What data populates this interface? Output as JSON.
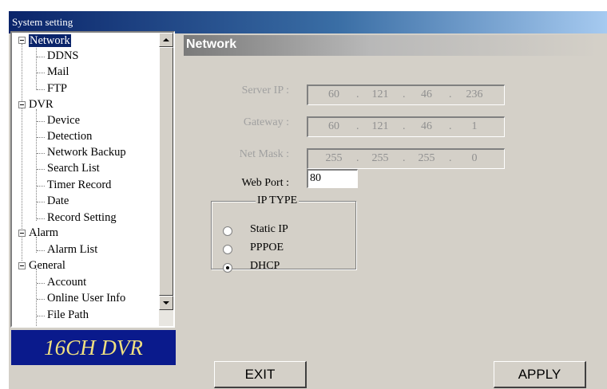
{
  "window": {
    "title": "System setting"
  },
  "tree": {
    "network": "Network",
    "ddns": "DDNS",
    "mail": "Mail",
    "ftp": "FTP",
    "dvr": "DVR",
    "device": "Device",
    "detection": "Detection",
    "network_backup": "Network Backup",
    "search_list": "Search List",
    "timer_record": "Timer Record",
    "date": "Date",
    "record_setting": "Record Setting",
    "alarm": "Alarm",
    "alarm_list": "Alarm List",
    "general": "General",
    "account": "Account",
    "online_user_info": "Online User Info",
    "file_path": "File Path"
  },
  "logo": {
    "text": "16CH DVR"
  },
  "panel": {
    "title": "Network"
  },
  "server_ip": {
    "label": "Server IP :",
    "octets": [
      "60",
      "121",
      "46",
      "236"
    ]
  },
  "gateway": {
    "label": "Gateway :",
    "octets": [
      "60",
      "121",
      "46",
      "1"
    ]
  },
  "net_mask": {
    "label": "Net Mask :",
    "octets": [
      "255",
      "255",
      "255",
      "0"
    ]
  },
  "web_port": {
    "label": "Web Port :",
    "value": "80"
  },
  "ip_type": {
    "title": "IP TYPE",
    "options": [
      "Static IP",
      "PPPOE",
      "DHCP"
    ],
    "selected": "DHCP"
  },
  "buttons": {
    "exit": "EXIT",
    "apply": "APPLY"
  },
  "colors": {
    "title_bar": "#0a246a",
    "logo_bg": "#0a1a8c",
    "logo_text": "#f0e080",
    "selection": "#0a246a"
  }
}
